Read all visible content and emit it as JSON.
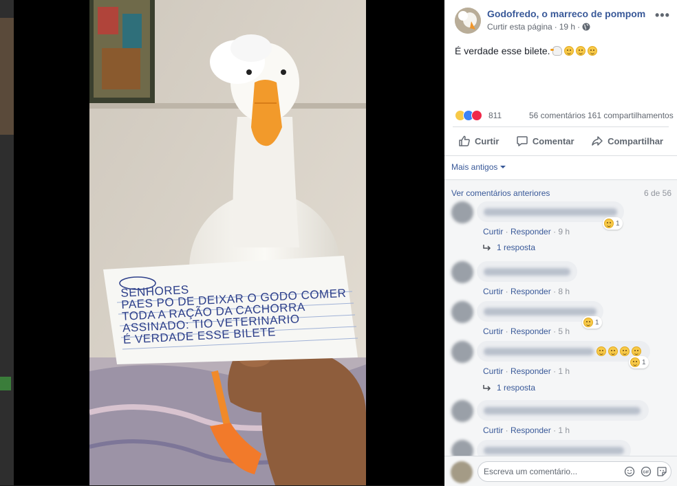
{
  "post": {
    "page_name": "Godofredo, o marreco de pompom",
    "like_page": "Curtir esta página",
    "time": "19 h",
    "audience_icon": "globe-icon",
    "text": "É verdade esse bilete."
  },
  "photo": {
    "note_lines": [
      "SENHORES",
      "PAES PO DE DEIXAR O GODO COMER",
      "TODA A RAÇÃO DA CACHORRA",
      "ASSINADO: TIO VETERINARIO",
      "É VERDADE ESSE BILETE"
    ]
  },
  "stats": {
    "reactions": "811",
    "comments": "56 comentários",
    "shares": "161 compartilhamentos"
  },
  "actions": {
    "like": "Curtir",
    "comment": "Comentar",
    "share": "Compartilhar"
  },
  "comments_section": {
    "sort_label": "Mais antigos",
    "previous_link": "Ver comentários anteriores",
    "paging": "6 de 56",
    "like_label": "Curtir",
    "reply_label": "Responder",
    "items": [
      {
        "time": "9 h",
        "reaction_count": "1",
        "replies": "1 resposta"
      },
      {
        "time": "8 h"
      },
      {
        "time": "5 h",
        "reaction_count": "1"
      },
      {
        "time": "1 h",
        "reaction_count": "1",
        "replies": "1 resposta"
      },
      {
        "time": "1 h"
      }
    ]
  },
  "composer": {
    "placeholder": "Escreva um comentário..."
  },
  "colors": {
    "link": "#385898",
    "panel_bg": "#ffffff",
    "viewer_bg": "#000000"
  }
}
